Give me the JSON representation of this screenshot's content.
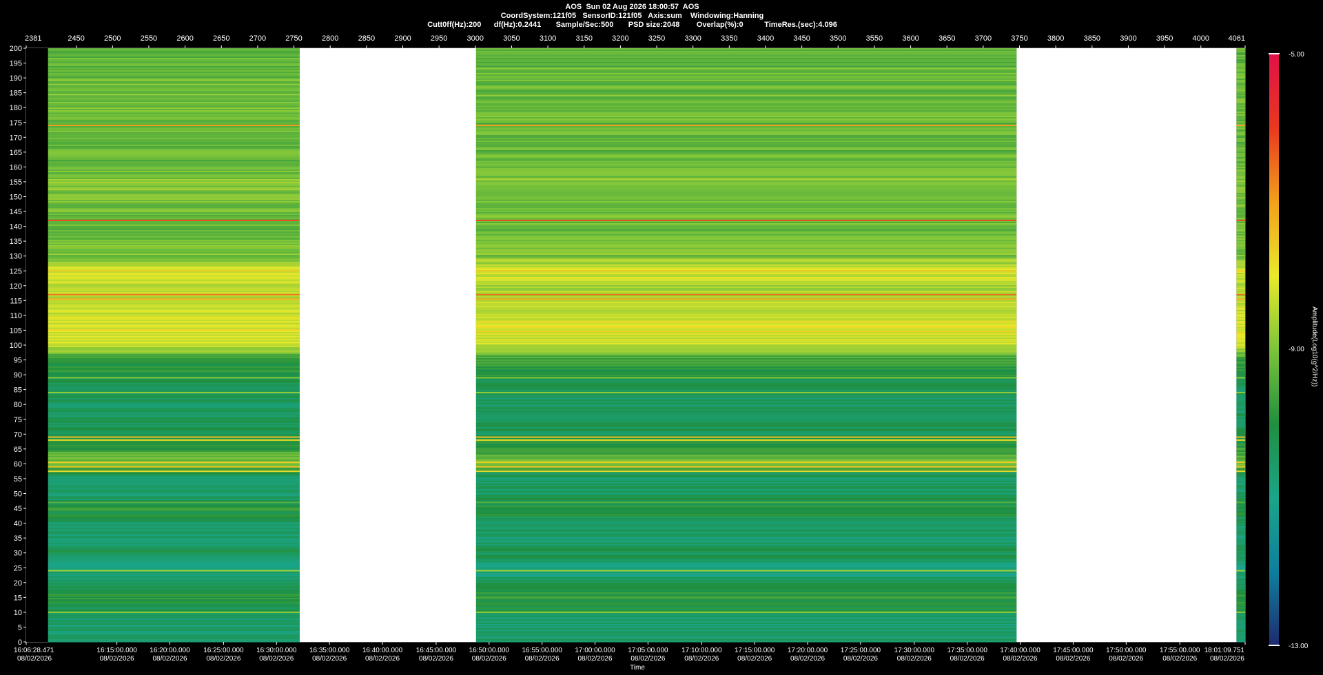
{
  "header": {
    "line1": "AOS  Sun 02 Aug 2026 18:00:57  AOS",
    "line2": "CoordSystem:121f05   SensorID:121f05   Axis:sum    Windowing:Hanning",
    "line3": "Cutt0ff(Hz):200      df(Hz):0.2441       Sample/Sec:500       PSD size:2048        Overlap(%):0          TimeRes.(sec):4.096"
  },
  "colors": {
    "background": "#000000",
    "gap": "#ffffff",
    "colormap": [
      "#1f2a6e",
      "#0e7f9e",
      "#1aa58a",
      "#1f8f3e",
      "#7cc43a",
      "#e9e92a",
      "#f2a01c",
      "#e8381e",
      "#e01048"
    ]
  },
  "chart_data": {
    "type": "heatmap",
    "title": "",
    "xlabel": "Time",
    "ylabel": "",
    "x_range": [
      2381,
      4061
    ],
    "y_range": [
      0,
      200
    ],
    "top_tick_labels": [
      "2381",
      "2450",
      "2500",
      "2550",
      "2600",
      "2650",
      "2700",
      "2750",
      "2800",
      "2850",
      "2900",
      "2950",
      "3000",
      "3050",
      "3100",
      "3150",
      "3200",
      "3250",
      "3300",
      "3350",
      "3400",
      "3450",
      "3500",
      "3550",
      "3600",
      "3650",
      "3700",
      "3750",
      "3800",
      "3850",
      "3900",
      "3950",
      "4000",
      "4061"
    ],
    "top_tick_values": [
      2381,
      2450,
      2500,
      2550,
      2600,
      2650,
      2700,
      2750,
      2800,
      2850,
      2900,
      2950,
      3000,
      3050,
      3100,
      3150,
      3200,
      3250,
      3300,
      3350,
      3400,
      3450,
      3500,
      3550,
      3600,
      3650,
      3700,
      3750,
      3800,
      3850,
      3900,
      3950,
      4000,
      4061
    ],
    "y_tick_labels": [
      "0",
      "5",
      "10",
      "15",
      "20",
      "25",
      "30",
      "35",
      "40",
      "45",
      "50",
      "55",
      "60",
      "65",
      "70",
      "75",
      "80",
      "85",
      "90",
      "95",
      "100",
      "105",
      "110",
      "115",
      "120",
      "125",
      "130",
      "135",
      "140",
      "145",
      "150",
      "155",
      "160",
      "165",
      "170",
      "175",
      "180",
      "185",
      "190",
      "195",
      "200"
    ],
    "bottom_tick_times": [
      "16:06:28.471",
      "16:15:00.000",
      "16:20:00.000",
      "16:25:00.000",
      "16:30:00.000",
      "16:35:00.000",
      "16:40:00.000",
      "16:45:00.000",
      "16:50:00.000",
      "16:55:00.000",
      "17:00:00.000",
      "17:05:00.000",
      "17:10:00.000",
      "17:15:00.000",
      "17:20:00.000",
      "17:25:00.000",
      "17:30:00.000",
      "17:35:00.000",
      "17:40:00.000",
      "17:45:00.000",
      "17:50:00.000",
      "17:55:00.000",
      "18:01:09.751"
    ],
    "bottom_tick_index": [
      2381,
      2506,
      2579,
      2653,
      2726,
      2799,
      2872,
      2946,
      3019,
      3092,
      3165,
      3238,
      3312,
      3385,
      3458,
      3531,
      3605,
      3678,
      3751,
      3824,
      3897,
      3971,
      4061
    ],
    "bottom_tick_date": "08/02/2026",
    "data_segments": [
      [
        2411,
        2758
      ],
      [
        3001,
        3746
      ],
      [
        4049,
        4061
      ]
    ],
    "colorbar": {
      "label": "Amplitude(Log10(g^2/Hz))",
      "min_label": "-13.00",
      "mid_label": "-9.00",
      "max_label": "-5.00",
      "min": -13,
      "max": -5
    },
    "frequency_profile": {
      "freq_hz": [
        0,
        5,
        10,
        15,
        20,
        25,
        30,
        35,
        40,
        45,
        50,
        55,
        57,
        60,
        65,
        70,
        75,
        80,
        85,
        90,
        95,
        100,
        105,
        110,
        115,
        120,
        125,
        130,
        140,
        150,
        155,
        160,
        170,
        180,
        190,
        200
      ],
      "amplitude": [
        -10.6,
        -10.7,
        -10.3,
        -9.8,
        -10.4,
        -11.0,
        -10.2,
        -10.6,
        -10.5,
        -9.9,
        -10.5,
        -10.6,
        -10.3,
        -8.9,
        -9.7,
        -10.3,
        -10.4,
        -10.5,
        -10.4,
        -10.0,
        -9.8,
        -8.4,
        -8.0,
        -8.2,
        -8.5,
        -8.6,
        -8.1,
        -9.0,
        -9.2,
        -9.0,
        -8.9,
        -9.2,
        -9.3,
        -9.1,
        -9.2,
        -9.3
      ]
    },
    "spectral_lines_hz": [
      {
        "f": 174,
        "amp": -7.0
      },
      {
        "f": 142,
        "amp": -6.2
      },
      {
        "f": 125,
        "amp": -7.6
      },
      {
        "f": 117,
        "amp": -6.6
      },
      {
        "f": 115.5,
        "amp": -7.2
      },
      {
        "f": 98,
        "amp": -8.6
      },
      {
        "f": 89,
        "amp": -8.9
      },
      {
        "f": 84,
        "amp": -8.8
      },
      {
        "f": 69,
        "amp": -7.4
      },
      {
        "f": 68,
        "amp": -7.8
      },
      {
        "f": 60.5,
        "amp": -7.6
      },
      {
        "f": 59,
        "amp": -7.5
      },
      {
        "f": 57.5,
        "amp": -7.8
      },
      {
        "f": 47,
        "amp": -9.4
      },
      {
        "f": 24,
        "amp": -8.7
      },
      {
        "f": 10,
        "amp": -8.8
      }
    ]
  }
}
